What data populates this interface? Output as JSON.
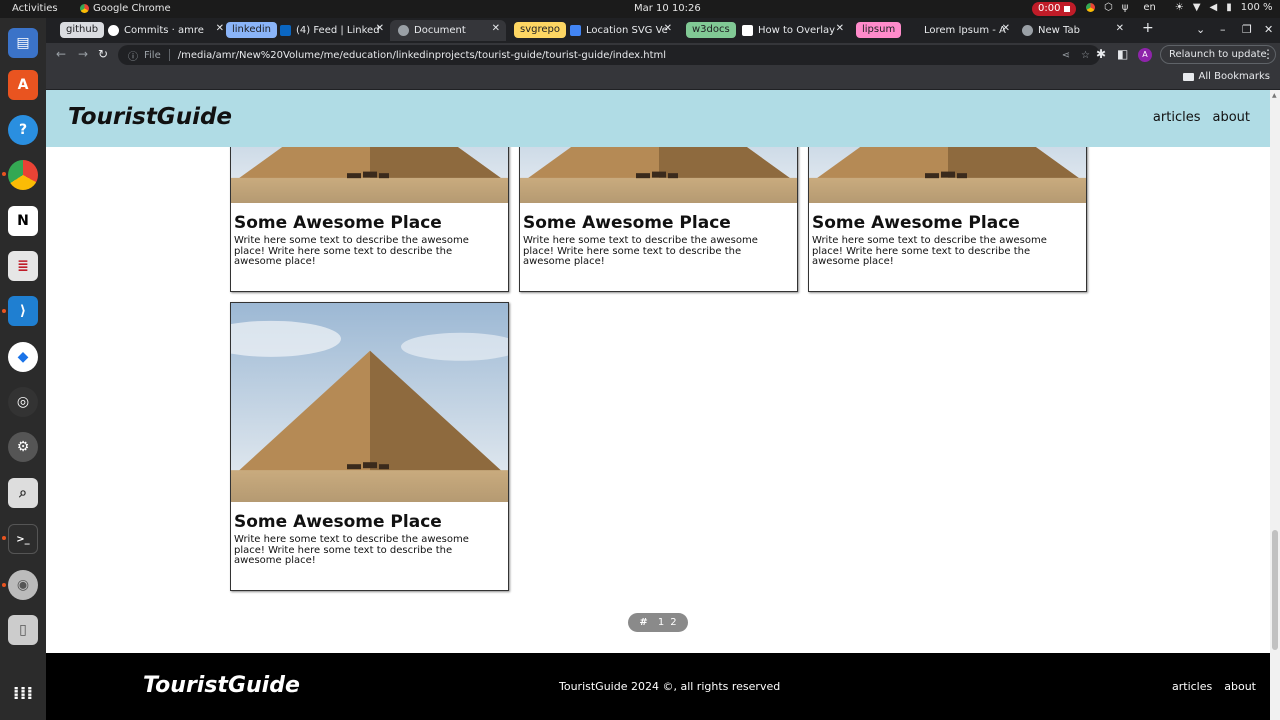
{
  "system": {
    "activities": "Activities",
    "app_name": "Google Chrome",
    "clock": "Mar 10  10:26",
    "recording": "0:00",
    "lang": "en",
    "battery": "100 %"
  },
  "tabs": [
    {
      "group": "github",
      "group_color": "#dadce0",
      "group_text": "#202124"
    },
    {
      "label": "Commits · amre",
      "fav": "#ffffff"
    },
    {
      "group": "linkedin",
      "group_color": "#8ab4f8",
      "group_text": "#202124"
    },
    {
      "label": "(4) Feed | Linked",
      "fav": "#0a66c2"
    },
    {
      "label": "Document",
      "fav": "#9aa0a6",
      "active": true
    },
    {
      "group": "svgrepo",
      "group_color": "#fdd663",
      "group_text": "#202124"
    },
    {
      "label": "Location SVG Ve",
      "fav": "#4285f4"
    },
    {
      "group": "w3docs",
      "group_color": "#81c995",
      "group_text": "#202124"
    },
    {
      "label": "How to Overlay",
      "fav": "#ffffff"
    },
    {
      "group": "lipsum",
      "group_color": "#ff8bcb",
      "group_text": "#202124"
    },
    {
      "label": "Lorem Ipsum - A",
      "fav": "#202124"
    },
    {
      "label": "New Tab",
      "fav": "#9aa0a6"
    }
  ],
  "omnibox": {
    "scheme_label": "File",
    "url": "/media/amr/New%20Volume/me/education/linkedinprojects/tourist-guide/tourist-guide/index.html"
  },
  "toolbar": {
    "relaunch": "Relaunch to update",
    "profile_initial": "A",
    "all_bookmarks": "All Bookmarks"
  },
  "site": {
    "brand": "TouristGuide",
    "nav": [
      "articles",
      "about"
    ],
    "cards": [
      {
        "title": "Some Awesome Place",
        "text": "Write here some text to describe the awesome place! Write here some text to describe the awesome place!"
      },
      {
        "title": "Some Awesome Place",
        "text": "Write here some text to describe the awesome place! Write here some text to describe the awesome place!"
      },
      {
        "title": "Some Awesome Place",
        "text": "Write here some text to describe the awesome place! Write here some text to describe the awesome place!"
      },
      {
        "title": "Some Awesome Place",
        "text": "Write here some text to describe the awesome place! Write here some text to describe the awesome place!"
      }
    ],
    "pager": {
      "hash": "#",
      "pages": [
        "1",
        "2"
      ]
    },
    "footer": {
      "brand": "TouristGuide",
      "copyright": "TouristGuide 2024 ©, all rights reserved",
      "nav": [
        "articles",
        "about"
      ]
    }
  },
  "colors": {
    "header_bg": "#b0dce5",
    "footer_bg": "#000000",
    "pager_bg": "#8a8a8a"
  }
}
